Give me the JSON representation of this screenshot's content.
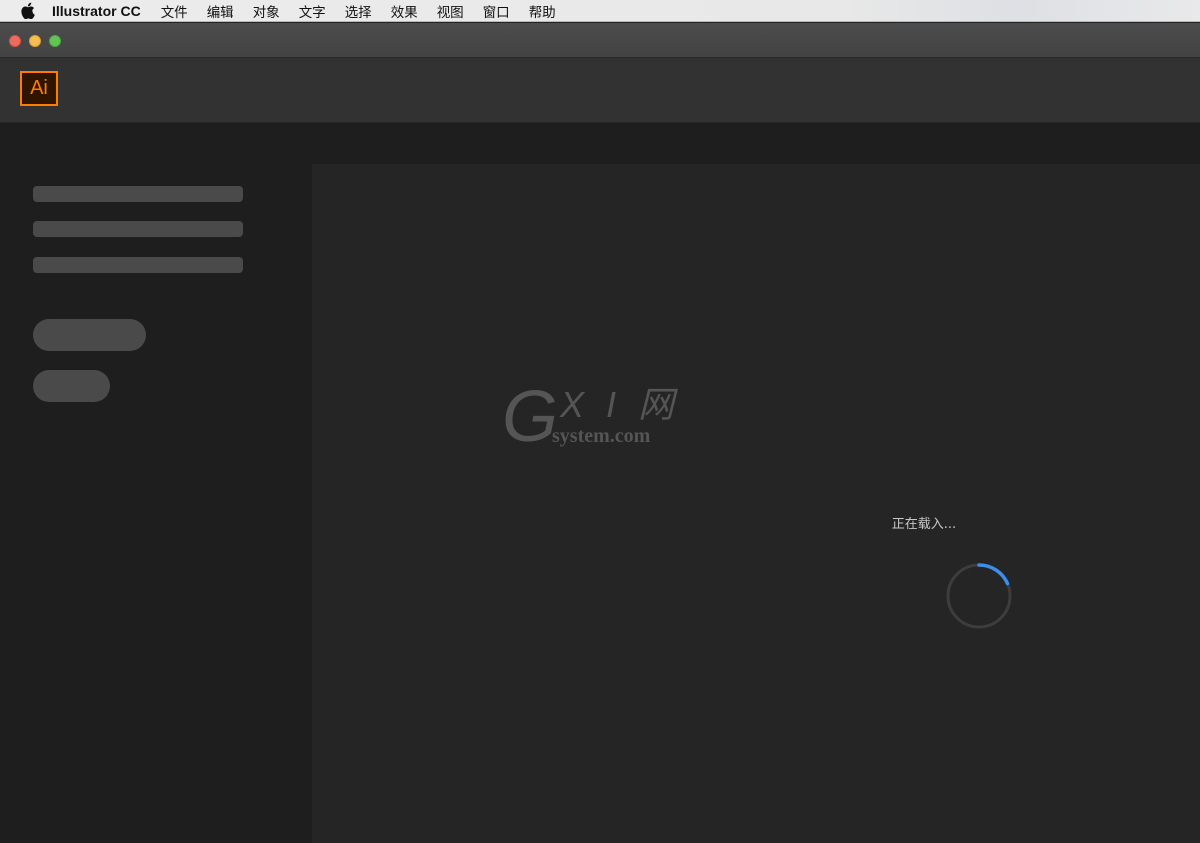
{
  "menubar": {
    "app_name": "Illustrator CC",
    "items": [
      "文件",
      "编辑",
      "对象",
      "文字",
      "选择",
      "效果",
      "视图",
      "窗口",
      "帮助"
    ]
  },
  "window": {
    "buttons": [
      "close",
      "minimize",
      "zoom"
    ],
    "logo_text": "Ai"
  },
  "icons": {
    "menu": "apple-icon",
    "spinner": "loading-spinner-icon"
  },
  "watermark": {
    "mark": "G",
    "name": "X I 网",
    "domain": "system.com"
  },
  "loading": {
    "text": "正在载入..."
  },
  "colors": {
    "brand_orange": "#ff7c00",
    "logo_bg": "#2f1500",
    "spinner_accent": "#3b8fe8",
    "spinner_track": "#3d3d3d"
  }
}
